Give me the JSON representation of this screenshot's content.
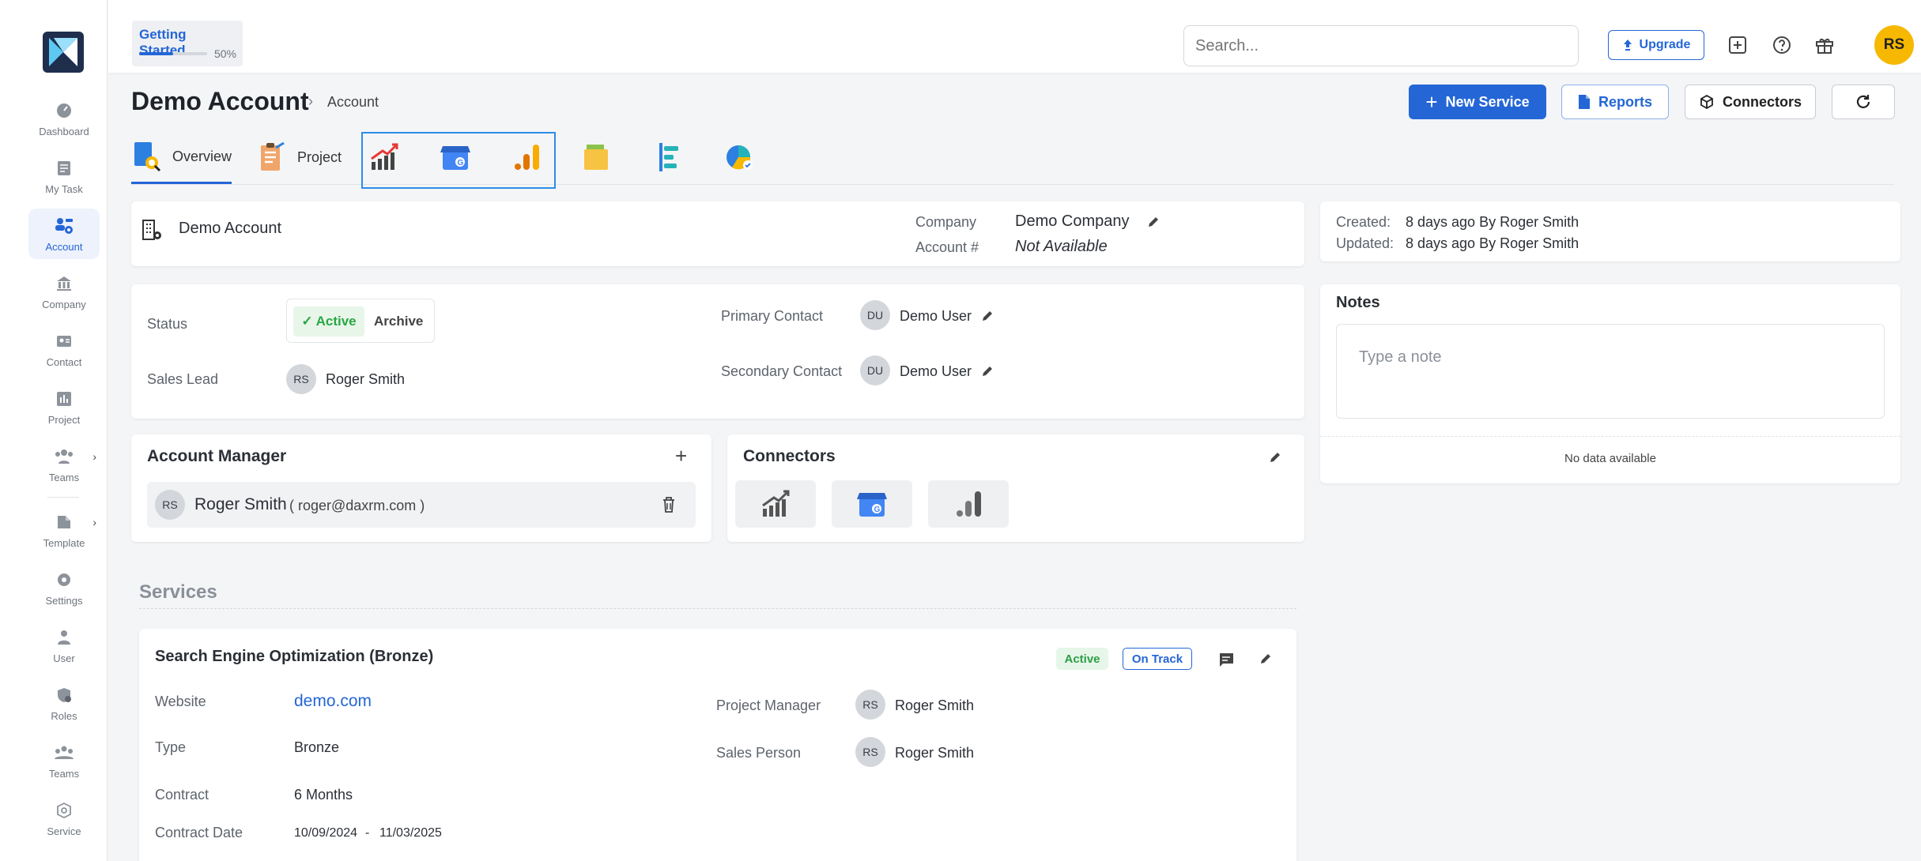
{
  "sidebar": {
    "items": [
      {
        "label": "Dashboard",
        "icon": "gauge-icon",
        "active": false
      },
      {
        "label": "My Task",
        "icon": "task-list-icon",
        "active": false
      },
      {
        "label": "Account",
        "icon": "account-users-icon",
        "active": true
      },
      {
        "label": "Company",
        "icon": "bank-building-icon",
        "active": false
      },
      {
        "label": "Contact",
        "icon": "contact-card-icon",
        "active": false
      },
      {
        "label": "Project",
        "icon": "bar-chart-icon",
        "active": false
      },
      {
        "label": "Teams",
        "icon": "team-icon",
        "active": false
      },
      {
        "label": "Template",
        "icon": "template-icon",
        "active": false
      },
      {
        "label": "Settings",
        "icon": "gear-icon",
        "active": false
      },
      {
        "label": "User",
        "icon": "user-icon",
        "active": false
      },
      {
        "label": "Roles",
        "icon": "roles-shield-icon",
        "active": false
      },
      {
        "label": "Teams",
        "icon": "team-group-icon",
        "active": false
      },
      {
        "label": "Service",
        "icon": "service-icon",
        "active": false
      }
    ]
  },
  "topbar": {
    "getting_started": {
      "label": "Getting Started",
      "percent_text": "50%",
      "progress": 0.5
    },
    "search_placeholder": "Search...",
    "upgrade_label": "Upgrade",
    "user_initials": "RS"
  },
  "header": {
    "title": "Demo Account",
    "breadcrumb": "Account",
    "buttons": {
      "new_service": "New Service",
      "reports": "Reports",
      "connectors": "Connectors"
    }
  },
  "tabs": {
    "overview": "Overview",
    "project": "Project"
  },
  "account_card": {
    "name": "Demo Account",
    "company_label": "Company",
    "company_value": "Demo Company",
    "account_no_label": "Account #",
    "account_no_value": "Not Available"
  },
  "meta_card": {
    "created_label": "Created:",
    "created_value": "8 days ago By Roger Smith",
    "updated_label": "Updated:",
    "updated_value": "8 days ago By Roger Smith"
  },
  "details_card": {
    "status_label": "Status",
    "status_active": "Active",
    "status_archive": "Archive",
    "sales_lead_label": "Sales Lead",
    "sales_lead_initials": "RS",
    "sales_lead_name": "Roger Smith",
    "primary_contact_label": "Primary Contact",
    "primary_contact_initials": "DU",
    "primary_contact_name": "Demo User",
    "secondary_contact_label": "Secondary Contact",
    "secondary_contact_initials": "DU",
    "secondary_contact_name": "Demo User"
  },
  "notes_card": {
    "title": "Notes",
    "placeholder": "Type a note",
    "empty": "No data available"
  },
  "manager_card": {
    "title": "Account Manager",
    "initials": "RS",
    "name": "Roger Smith",
    "email": "( roger@daxrm.com )"
  },
  "connectors_card": {
    "title": "Connectors"
  },
  "services": {
    "title": "Services",
    "service": {
      "name": "Search Engine Optimization (Bronze)",
      "badge_status": "Active",
      "badge_track": "On Track",
      "website_label": "Website",
      "website_value": "demo.com",
      "type_label": "Type",
      "type_value": "Bronze",
      "contract_label": "Contract",
      "contract_value": "6 Months",
      "contract_date_label": "Contract Date",
      "contract_start": "10/09/2024",
      "contract_sep": "-",
      "contract_end": "11/03/2025",
      "pm_label": "Project Manager",
      "pm_initials": "RS",
      "pm_name": "Roger Smith",
      "sp_label": "Sales Person",
      "sp_initials": "RS",
      "sp_name": "Roger Smith"
    }
  },
  "colors": {
    "primary": "#2466d6",
    "active_green": "#29a745",
    "avatar_yellow": "#f6b800"
  }
}
